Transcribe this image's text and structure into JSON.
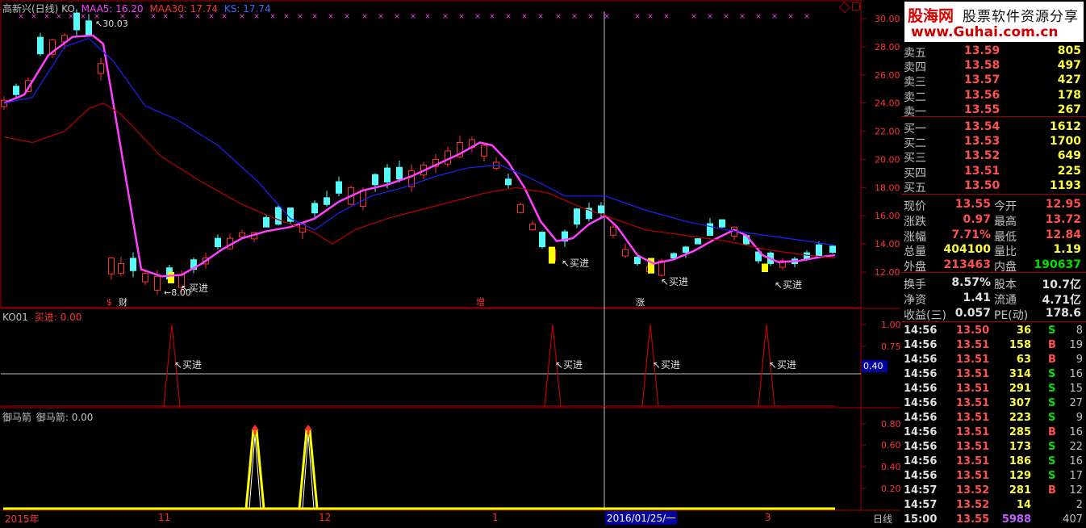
{
  "header": {
    "stock": "高新兴(日线) KO",
    "ma5": "MAA5: 16.20",
    "ma30": "MAA30: 17.74",
    "ks": "KS: 17.74"
  },
  "main_chart": {
    "price_axis": [
      "30.00",
      "28.00",
      "26.00",
      "24.00",
      "22.00",
      "20.00",
      "18.00",
      "16.00",
      "14.00",
      "12.00"
    ],
    "high_label": "30.03",
    "low_label": "8.00",
    "buy_label": "买进",
    "markers": {
      "cai": "财",
      "dollar": "$",
      "zeng": "增",
      "zhang": "涨"
    },
    "colors": {
      "up": "#ff3232",
      "down": "#54fcfc",
      "ma5": "#ff40ff",
      "ma_blue": "#2020ff",
      "ma_red": "#c00000",
      "signal": "#ffff00"
    }
  },
  "ko_panel": {
    "title": "KO01",
    "value": "买进: 0.00",
    "axis": [
      "1.00",
      "0.75",
      "0.40"
    ],
    "buy_label": "买进"
  },
  "arrow_panel": {
    "title": "御马箭",
    "value": "御马箭: 0.00",
    "axis": [
      "0.80",
      "0.60",
      "0.40",
      "0.20"
    ]
  },
  "time_axis": {
    "labels": [
      "2015年",
      "11",
      "12",
      "1",
      "2016/01/25/一",
      "3"
    ],
    "period": "日线"
  },
  "logo": {
    "name": "股海网",
    "slogan": "股票软件资源分享",
    "url": "www.Guhai.com.cn"
  },
  "order_book": {
    "asks": [
      {
        "label": "卖五",
        "price": "13.59",
        "vol": "805"
      },
      {
        "label": "卖四",
        "price": "13.58",
        "vol": "497"
      },
      {
        "label": "卖三",
        "price": "13.57",
        "vol": "427"
      },
      {
        "label": "卖二",
        "price": "13.56",
        "vol": "178"
      },
      {
        "label": "卖一",
        "price": "13.55",
        "vol": "267"
      }
    ],
    "bids": [
      {
        "label": "买一",
        "price": "13.54",
        "vol": "1612"
      },
      {
        "label": "买二",
        "price": "13.53",
        "vol": "1700"
      },
      {
        "label": "买三",
        "price": "13.52",
        "vol": "649"
      },
      {
        "label": "买四",
        "price": "13.51",
        "vol": "225"
      },
      {
        "label": "买五",
        "price": "13.50",
        "vol": "1193"
      }
    ]
  },
  "stats": {
    "xianjia_l": "现价",
    "xianjia": "13.55",
    "jinkai_l": "今开",
    "jinkai": "12.95",
    "zhangdie_l": "涨跌",
    "zhangdie": "0.97",
    "zuigao_l": "最高",
    "zuigao": "13.72",
    "zhangfu_l": "涨幅",
    "zhangfu": "7.71%",
    "zuidi_l": "最低",
    "zuidi": "12.84",
    "zongliang_l": "总量",
    "zongliang": "404100",
    "liangbi_l": "量比",
    "liangbi": "1.19",
    "waipan_l": "外盘",
    "waipan": "213463",
    "neipan_l": "内盘",
    "neipan": "190637",
    "huanshou_l": "换手",
    "huanshou": "8.57%",
    "guben_l": "股本",
    "guben": "10.7亿",
    "jingzi_l": "净资",
    "jingzi": "1.41",
    "liutong_l": "流通",
    "liutong": "4.71亿",
    "shouyi_l": "收益(三)",
    "shouyi": "0.057",
    "pe_l": "PE(动)",
    "pe": "178.6"
  },
  "ticks": [
    {
      "time": "14:56",
      "price": "13.50",
      "vol": "36",
      "side": "S",
      "n": "8"
    },
    {
      "time": "14:56",
      "price": "13.51",
      "vol": "158",
      "side": "B",
      "n": "19"
    },
    {
      "time": "14:56",
      "price": "13.51",
      "vol": "63",
      "side": "B",
      "n": "9"
    },
    {
      "time": "14:56",
      "price": "13.51",
      "vol": "314",
      "side": "S",
      "n": "16"
    },
    {
      "time": "14:56",
      "price": "13.51",
      "vol": "291",
      "side": "S",
      "n": "15"
    },
    {
      "time": "14:56",
      "price": "13.51",
      "vol": "307",
      "side": "S",
      "n": "27"
    },
    {
      "time": "14:56",
      "price": "13.51",
      "vol": "223",
      "side": "S",
      "n": "9"
    },
    {
      "time": "14:56",
      "price": "13.51",
      "vol": "285",
      "side": "B",
      "n": "16"
    },
    {
      "time": "14:56",
      "price": "13.51",
      "vol": "173",
      "side": "S",
      "n": "22"
    },
    {
      "time": "14:56",
      "price": "13.51",
      "vol": "186",
      "side": "S",
      "n": "16"
    },
    {
      "time": "14:56",
      "price": "13.51",
      "vol": "129",
      "side": "S",
      "n": "17"
    },
    {
      "time": "14:57",
      "price": "13.52",
      "vol": "281",
      "side": "B",
      "n": "12"
    },
    {
      "time": "14:57",
      "price": "13.52",
      "vol": "14",
      "side": "",
      "n": "2"
    },
    {
      "time": "15:00",
      "price": "13.55",
      "vol": "5988",
      "side": "",
      "n": "407"
    }
  ]
}
